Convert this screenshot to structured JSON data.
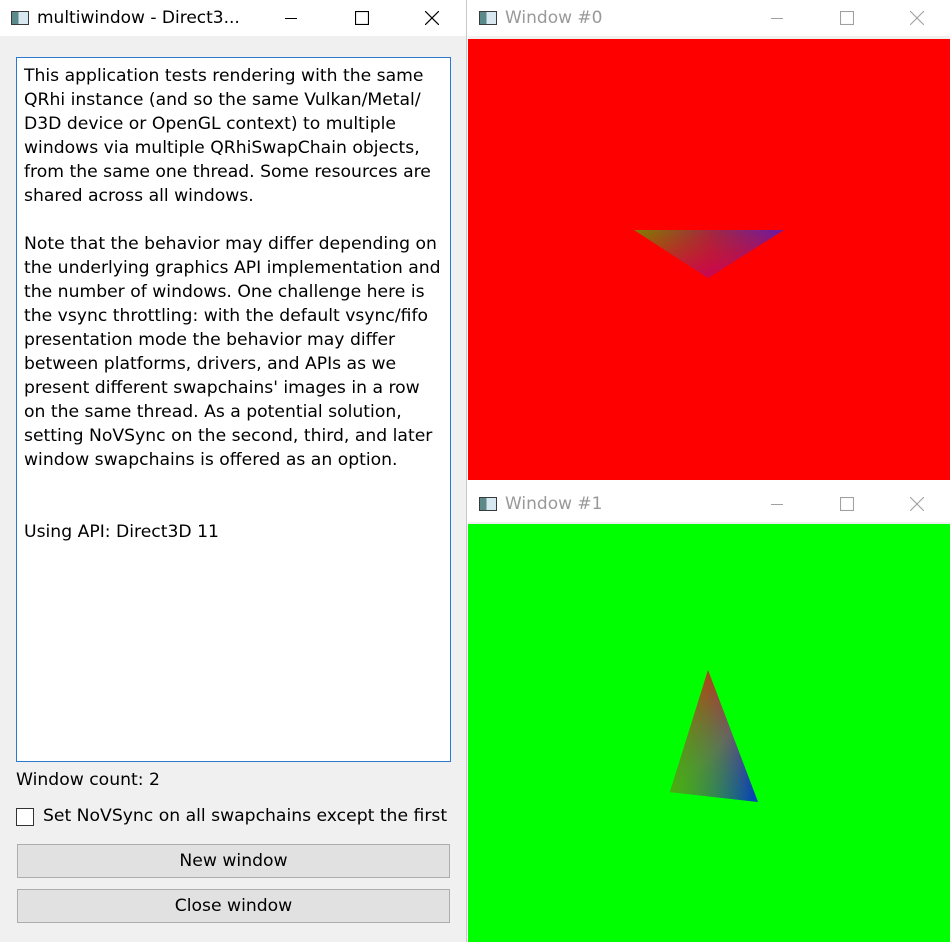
{
  "main_window": {
    "title": "multiwindow - Direct3...",
    "description_paragraphs": [
      "This application tests rendering with the same\nQRhi instance (and so the same Vulkan/Metal/\nD3D device or OpenGL context) to multiple\nwindows via multiple QRhiSwapChain objects,\nfrom the same one thread. Some resources are\nshared across all windows.",
      "Note that the behavior may differ depending on\nthe underlying graphics API implementation and\nthe number of windows. One challenge here is\nthe vsync throttling: with the default vsync/fifo\npresentation mode the behavior may differ\nbetween platforms, drivers, and APIs as we\npresent different swapchains' images in a row\non the same thread. As a potential solution,\nsetting NoVSync on the second, third, and later\nwindow swapchains is offered as an option."
    ],
    "api_text": "Using API: Direct3D 11",
    "window_count_label": "Window count: 2",
    "novsync_checkbox": {
      "label": "Set NoVSync on all swapchains except the first",
      "checked": false
    },
    "new_window_button": "New window",
    "close_window_button": "Close window"
  },
  "render_windows": [
    {
      "title": "Window #0",
      "clear_color": "#ff0000",
      "active": false
    },
    {
      "title": "Window #1",
      "clear_color": "#00ff00",
      "active": false
    }
  ],
  "triangle_colors": {
    "vertex_a": "#ff0000",
    "vertex_b": "#00ff00",
    "vertex_c": "#0000ff"
  }
}
